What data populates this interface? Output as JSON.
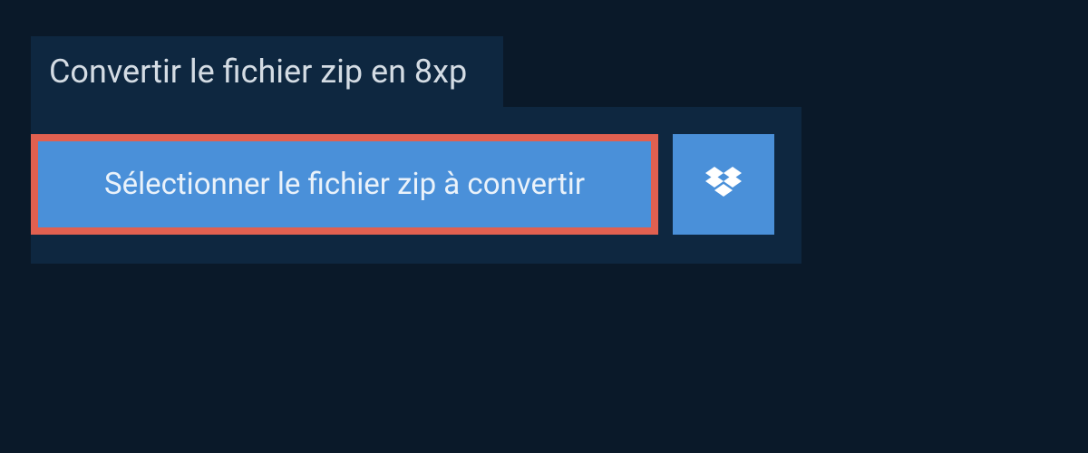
{
  "header": {
    "title": "Convertir le fichier zip en 8xp"
  },
  "upload": {
    "select_label": "Sélectionner le fichier zip à convertir",
    "dropbox_icon": "dropbox-icon"
  },
  "colors": {
    "background": "#0a1929",
    "panel": "#0e2740",
    "button": "#4a90d9",
    "highlight_border": "#e16050"
  }
}
